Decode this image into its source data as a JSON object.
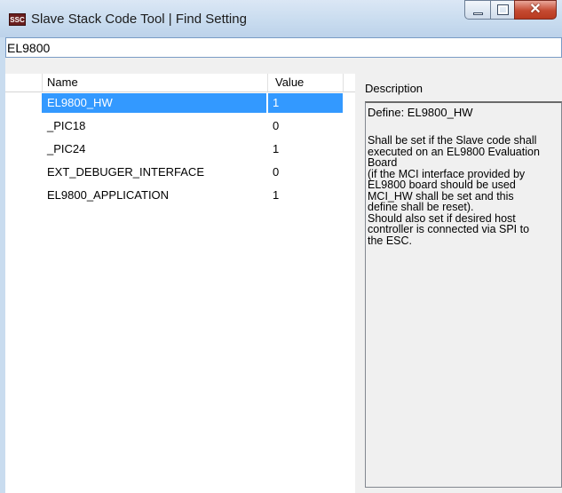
{
  "window": {
    "app_icon_text": "SSC",
    "title": "Slave Stack Code Tool | Find Setting",
    "minimize_glyph": "",
    "maximize_glyph": "",
    "close_glyph": "✕"
  },
  "search": {
    "value": "EL9800",
    "placeholder": ""
  },
  "grid": {
    "columns": [
      "Name",
      "Value"
    ],
    "rows": [
      {
        "name": "EL9800_HW",
        "value": "1",
        "selected": true
      },
      {
        "name": "_PIC18",
        "value": "0",
        "selected": false
      },
      {
        "name": "_PIC24",
        "value": "1",
        "selected": false
      },
      {
        "name": "EXT_DEBUGER_INTERFACE",
        "value": "0",
        "selected": false
      },
      {
        "name": "EL9800_APPLICATION",
        "value": "1",
        "selected": false
      }
    ]
  },
  "description": {
    "label": "Description",
    "define": "Define: EL9800_HW",
    "text": "Shall be set if the Slave code shall\nexecuted on an EL9800 Evaluation\nBoard\n(if the MCI interface provided by\nEL9800 board should be used\nMCI_HW shall be set and this\ndefine shall be reset).\nShould also set if desired host\ncontroller is connected via SPI to\nthe ESC."
  },
  "colors": {
    "selection": "#3399ff",
    "titlebar": "#c9dcef",
    "close_button": "#c54a31"
  }
}
